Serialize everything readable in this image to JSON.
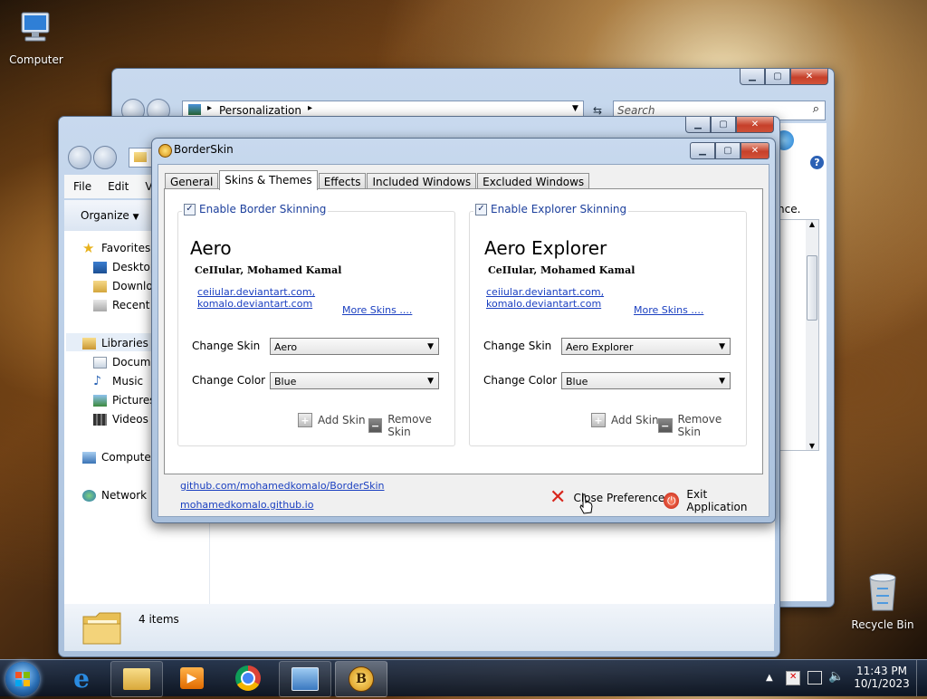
{
  "desktop": {
    "computer_label": "Computer",
    "recycle_label": "Recycle Bin"
  },
  "back_window": {
    "address": "Personalization",
    "search_placeholder": "Search",
    "partial_text": "nce."
  },
  "explorer": {
    "menu": [
      "File",
      "Edit",
      "Vie"
    ],
    "organize": "Organize",
    "nav": {
      "favorites": "Favorites",
      "desktop": "Desktop",
      "downloads": "Downloa",
      "recent": "Recent P",
      "libraries": "Libraries",
      "documents": "Docume",
      "music": "Music",
      "pictures": "Pictures",
      "videos": "Videos",
      "computer": "Computer",
      "network": "Network"
    },
    "status": "4 items"
  },
  "borderskin": {
    "title": "BorderSkin",
    "tabs": [
      "General",
      "Skins & Themes",
      "Effects",
      "Included Windows",
      "Excluded Windows"
    ],
    "active_tab": "Skins & Themes",
    "border_group": {
      "legend": "Enable Border Skinning",
      "skin_name": "Aero",
      "author": "CeIIular, Mohamed Kamal",
      "link1": "ceiiular.deviantart.com,",
      "link2": "komalo.deviantart.com",
      "more": "More Skins ....",
      "change_skin_label": "Change Skin",
      "skin_value": "Aero",
      "change_color_label": "Change Color",
      "color_value": "Blue",
      "add_label": "Add Skin",
      "remove_label": "Remove Skin"
    },
    "explorer_group": {
      "legend": "Enable Explorer Skinning",
      "skin_name": "Aero Explorer",
      "author": "CeIIular, Mohamed Kamal",
      "link1": "ceiiular.deviantart.com,",
      "link2": "komalo.deviantart.com",
      "more": "More Skins ....",
      "change_skin_label": "Change Skin",
      "skin_value": "Aero Explorer",
      "change_color_label": "Change Color",
      "color_value": "Blue",
      "add_label": "Add Skin",
      "remove_label": "Remove Skin"
    },
    "footer": {
      "github": "github.com/mohamedkomalo/BorderSkin",
      "site": "mohamedkomalo.github.io",
      "close_pref": "Close Preference",
      "exit_app": "Exit Application"
    }
  },
  "taskbar": {
    "time": "11:43 PM",
    "date": "10/1/2023"
  }
}
